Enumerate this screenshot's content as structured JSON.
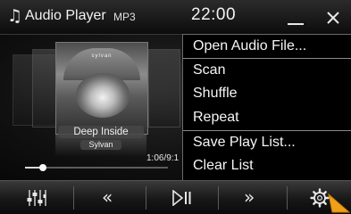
{
  "app": {
    "title": "Audio Player",
    "format": "MP3",
    "clock": "22:00"
  },
  "now_playing": {
    "cover_text": "sylvan",
    "title": "Deep Inside",
    "artist": "Sylvan",
    "time": "1:06/9:1",
    "progress": 0.125
  },
  "menu": {
    "items": [
      {
        "label": "Open Audio File..."
      },
      {
        "label": "Scan"
      },
      {
        "label": "Shuffle"
      },
      {
        "label": "Repeat"
      },
      {
        "label": "Save Play List..."
      },
      {
        "label": "Clear List"
      }
    ]
  },
  "toolbar": {
    "buttons": [
      "equalizer-icon",
      "rewind-icon",
      "play-pause-icon",
      "fast-forward-icon",
      "settings-gear-icon"
    ]
  },
  "colors": {
    "cursor": "#f0a018",
    "text": "#f5f5f5"
  }
}
